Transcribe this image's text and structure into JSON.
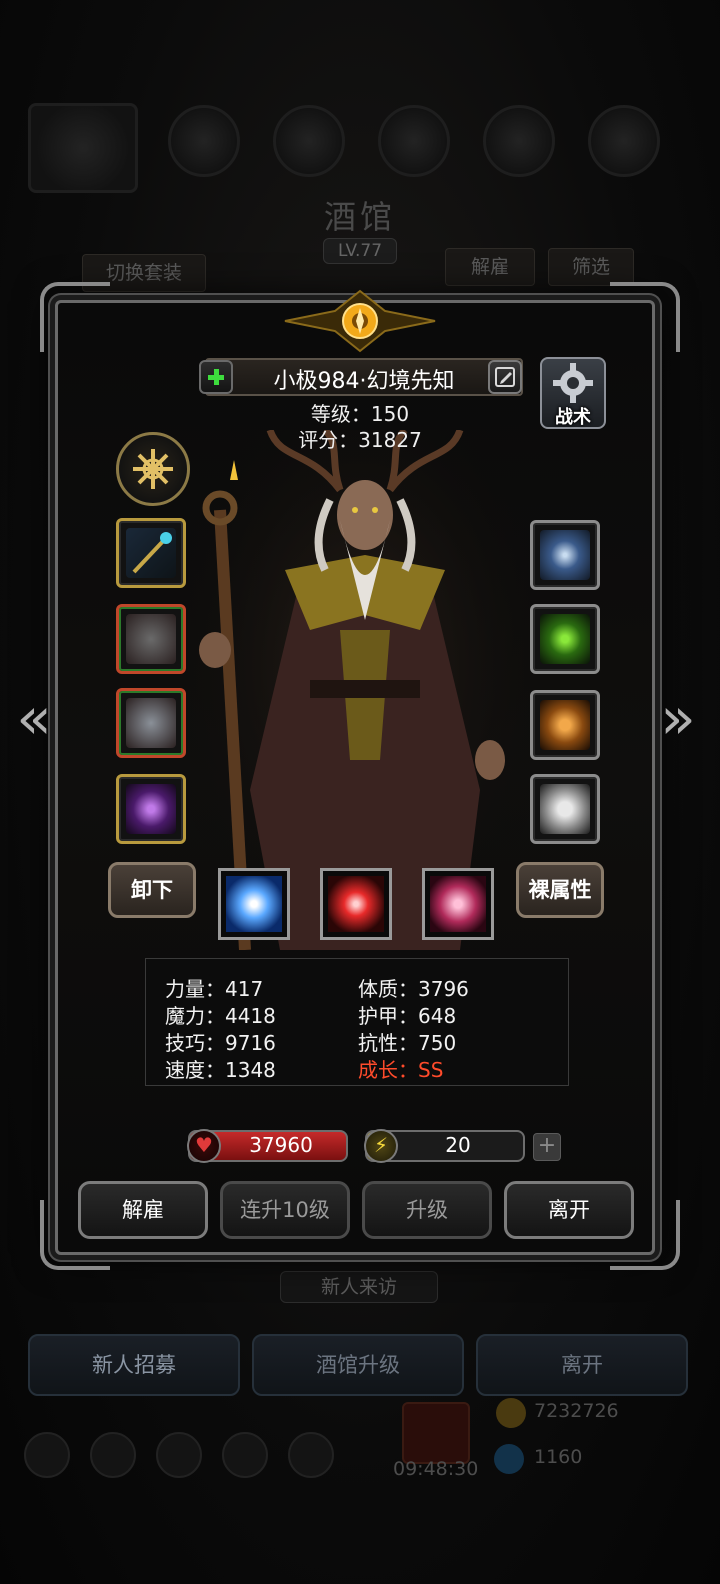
{
  "background": {
    "title": "酒馆",
    "level": "LV.77",
    "switch_outfit": "切换套装",
    "dismiss": "解雇",
    "filter": "筛选",
    "new_visitor": "新人来访",
    "bottom_buttons": [
      "新人招募",
      "酒馆升级",
      "离开"
    ],
    "gold_amount": "7232726",
    "gem_amount": "1160",
    "timer": "09:48:30"
  },
  "hero": {
    "name": "小极984·幻境先知",
    "level_line": "等级：150",
    "score_line": "评分：31827",
    "tactics_label": "战术",
    "unequip_label": "卸下",
    "bare_attr_label": "裸属性"
  },
  "attributes": {
    "strength": "力量：417",
    "magic": "魔力：4418",
    "skill": "技巧：9716",
    "speed": "速度：1348",
    "constitution": "体质：3796",
    "armor": "护甲：648",
    "resistance": "抗性：750",
    "growth": "成长：SS"
  },
  "resources": {
    "hp": "37960",
    "energy": "20",
    "energy_fill": 0.12
  },
  "actions": {
    "dismiss": "解雇",
    "level_up_10": "连升10级",
    "level_up": "升级",
    "leave": "离开"
  },
  "colors": {
    "growth": "#ff4b2b",
    "hp": "#c52a2a",
    "energy": "#d9c132"
  }
}
